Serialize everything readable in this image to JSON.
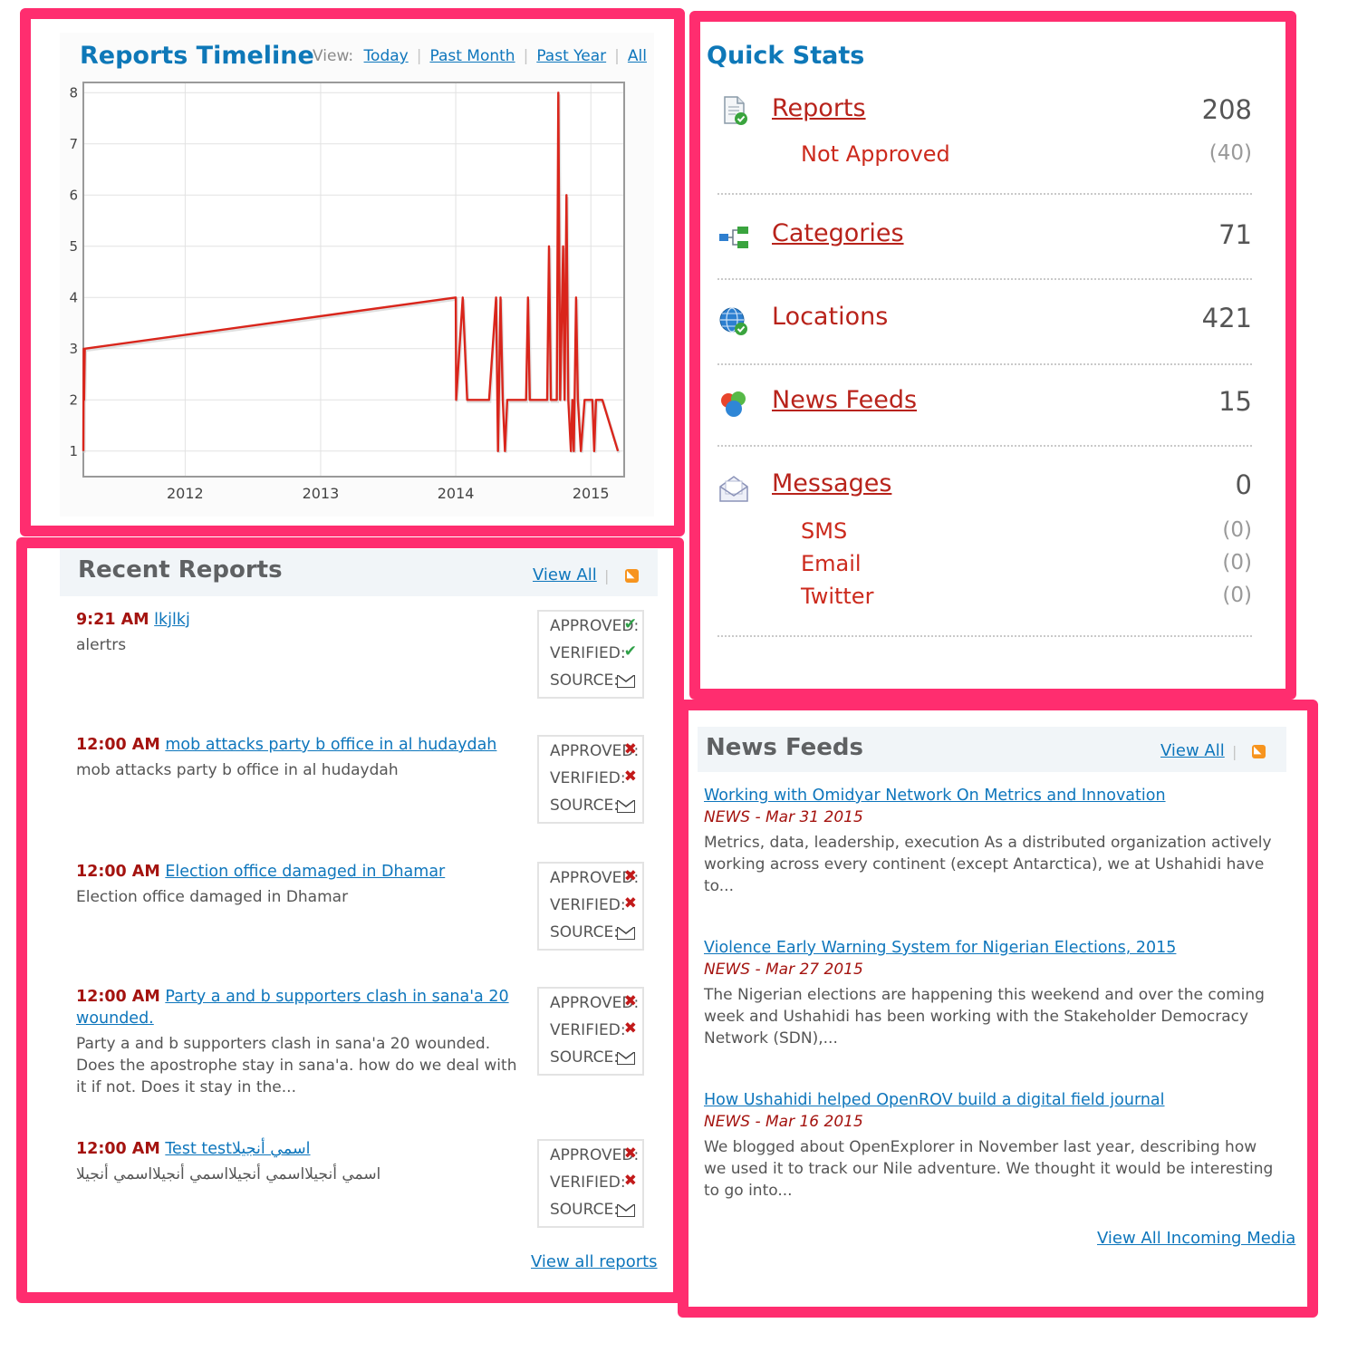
{
  "timeline": {
    "title": "Reports Timeline",
    "view_label": "View:",
    "view_links": [
      "Today",
      "Past Month",
      "Past Year",
      "All"
    ]
  },
  "chart_data": {
    "type": "line",
    "title": "",
    "xlabel": "",
    "ylabel": "",
    "x_ticks": [
      "2012",
      "2013",
      "2014",
      "2015"
    ],
    "y_ticks": [
      1,
      2,
      3,
      4,
      5,
      6,
      7,
      8
    ],
    "xlim": [
      "2011-04",
      "2015-04"
    ],
    "ylim": [
      0.5,
      8.2
    ],
    "grid": true,
    "series": [
      {
        "color": "#d9251b",
        "x": [
          "2011-04-01",
          "2011-04-02",
          "2011-04-03",
          "2011-04-05",
          "2014-01-01",
          "2014-01-02",
          "2014-01-20",
          "2014-02-01",
          "2014-02-05",
          "2014-04-01",
          "2014-04-20",
          "2014-04-25",
          "2014-05-02",
          "2014-05-08",
          "2014-05-14",
          "2014-05-20",
          "2014-06-01",
          "2014-07-10",
          "2014-07-15",
          "2014-07-20",
          "2014-08-20",
          "2014-09-05",
          "2014-09-10",
          "2014-09-15",
          "2014-09-25",
          "2014-10-01",
          "2014-10-05",
          "2014-10-10",
          "2014-10-18",
          "2014-10-22",
          "2014-10-27",
          "2014-11-01",
          "2014-11-08",
          "2014-11-12",
          "2014-11-16",
          "2014-11-22",
          "2014-11-27",
          "2014-12-05",
          "2014-12-15",
          "2014-12-18",
          "2015-01-05",
          "2015-01-10",
          "2015-01-15",
          "2015-02-01",
          "2015-03-15"
        ],
        "y": [
          1,
          3,
          2,
          3,
          4,
          2,
          4,
          2,
          2,
          2,
          4,
          1,
          4,
          2,
          1,
          2,
          2,
          2,
          4,
          2,
          2,
          2,
          5,
          2,
          2,
          2,
          8,
          2,
          5,
          2,
          6,
          2,
          1,
          2,
          1,
          4,
          2,
          1,
          2,
          2,
          2,
          1,
          2,
          2,
          1
        ]
      }
    ]
  },
  "quick_stats": {
    "title": "Quick Stats",
    "rows": [
      {
        "icon": "report-icon",
        "label": "Reports",
        "value": "208"
      },
      {
        "icon": "categories-icon",
        "label": "Categories",
        "value": "71"
      },
      {
        "icon": "globe-icon",
        "label": "Locations",
        "value": "421"
      },
      {
        "icon": "feeds-icon",
        "label": "News Feeds",
        "value": "15"
      },
      {
        "icon": "envelope-icon",
        "label": "Messages",
        "value": "0"
      }
    ],
    "not_approved": {
      "label": "Not Approved",
      "value": "(40)"
    },
    "messages_sub": [
      {
        "label": "SMS",
        "value": "(0)"
      },
      {
        "label": "Email",
        "value": "(0)"
      },
      {
        "label": "Twitter",
        "value": "(0)"
      }
    ]
  },
  "recent_reports": {
    "title": "Recent Reports",
    "view_all": "View All",
    "footer_link": "View all reports",
    "status_labels": {
      "approved": "APPROVED:",
      "verified": "VERIFIED:",
      "source": "SOURCE:"
    },
    "items": [
      {
        "time": "9:21 AM",
        "title": "lkjlkj",
        "desc": "alertrs",
        "approved": true,
        "verified": true
      },
      {
        "time": "12:00 AM",
        "title": "mob attacks party b office in al hudaydah",
        "desc": "mob attacks party b office in al hudaydah",
        "approved": false,
        "verified": false
      },
      {
        "time": "12:00 AM",
        "title": "Election office damaged in Dhamar",
        "desc": "Election office damaged in Dhamar",
        "approved": false,
        "verified": false
      },
      {
        "time": "12:00 AM",
        "title": "Party a and b supporters clash in sana'a 20 wounded.",
        "desc": "Party a and b supporters clash in sana'a 20 wounded. Does the apostrophe stay in sana'a. how do we deal with it if not. Does it stay in the...",
        "approved": false,
        "verified": false
      },
      {
        "time": "12:00 AM",
        "title": "اسمي أنجيلاTest test",
        "desc": "اسمي أنجيلااسمي أنجيلااسمي أنجيلااسمي أنجيلا",
        "approved": false,
        "verified": false
      }
    ]
  },
  "news_feeds": {
    "title": "News Feeds",
    "view_all": "View All",
    "footer_link": "View All Incoming Media",
    "items": [
      {
        "title": "Working with Omidyar Network On Metrics and Innovation",
        "meta": "NEWS - Mar 31 2015",
        "body": "Metrics, data, leadership, execution As a distributed organization actively working across every continent (except Antarctica), we at Ushahidi have to..."
      },
      {
        "title": "Violence Early Warning System for Nigerian Elections, 2015",
        "meta": "NEWS - Mar 27 2015",
        "body": "The Nigerian elections are happening this weekend and over the coming week and Ushahidi has been working with the Stakeholder Democracy Network (SDN),..."
      },
      {
        "title": "How Ushahidi helped OpenROV build a digital field journal",
        "meta": "NEWS - Mar 16 2015",
        "body": "We blogged about OpenExplorer in November last year, describing how we used it to track our Nile adventure. We thought it would be interesting to go into..."
      }
    ]
  },
  "colors": {
    "highlight_border": "#ff2d6f",
    "title_blue": "#0e78b8",
    "link_blue": "#0e76bc",
    "accent_red": "#b8231b",
    "line_red": "#d9251b"
  }
}
